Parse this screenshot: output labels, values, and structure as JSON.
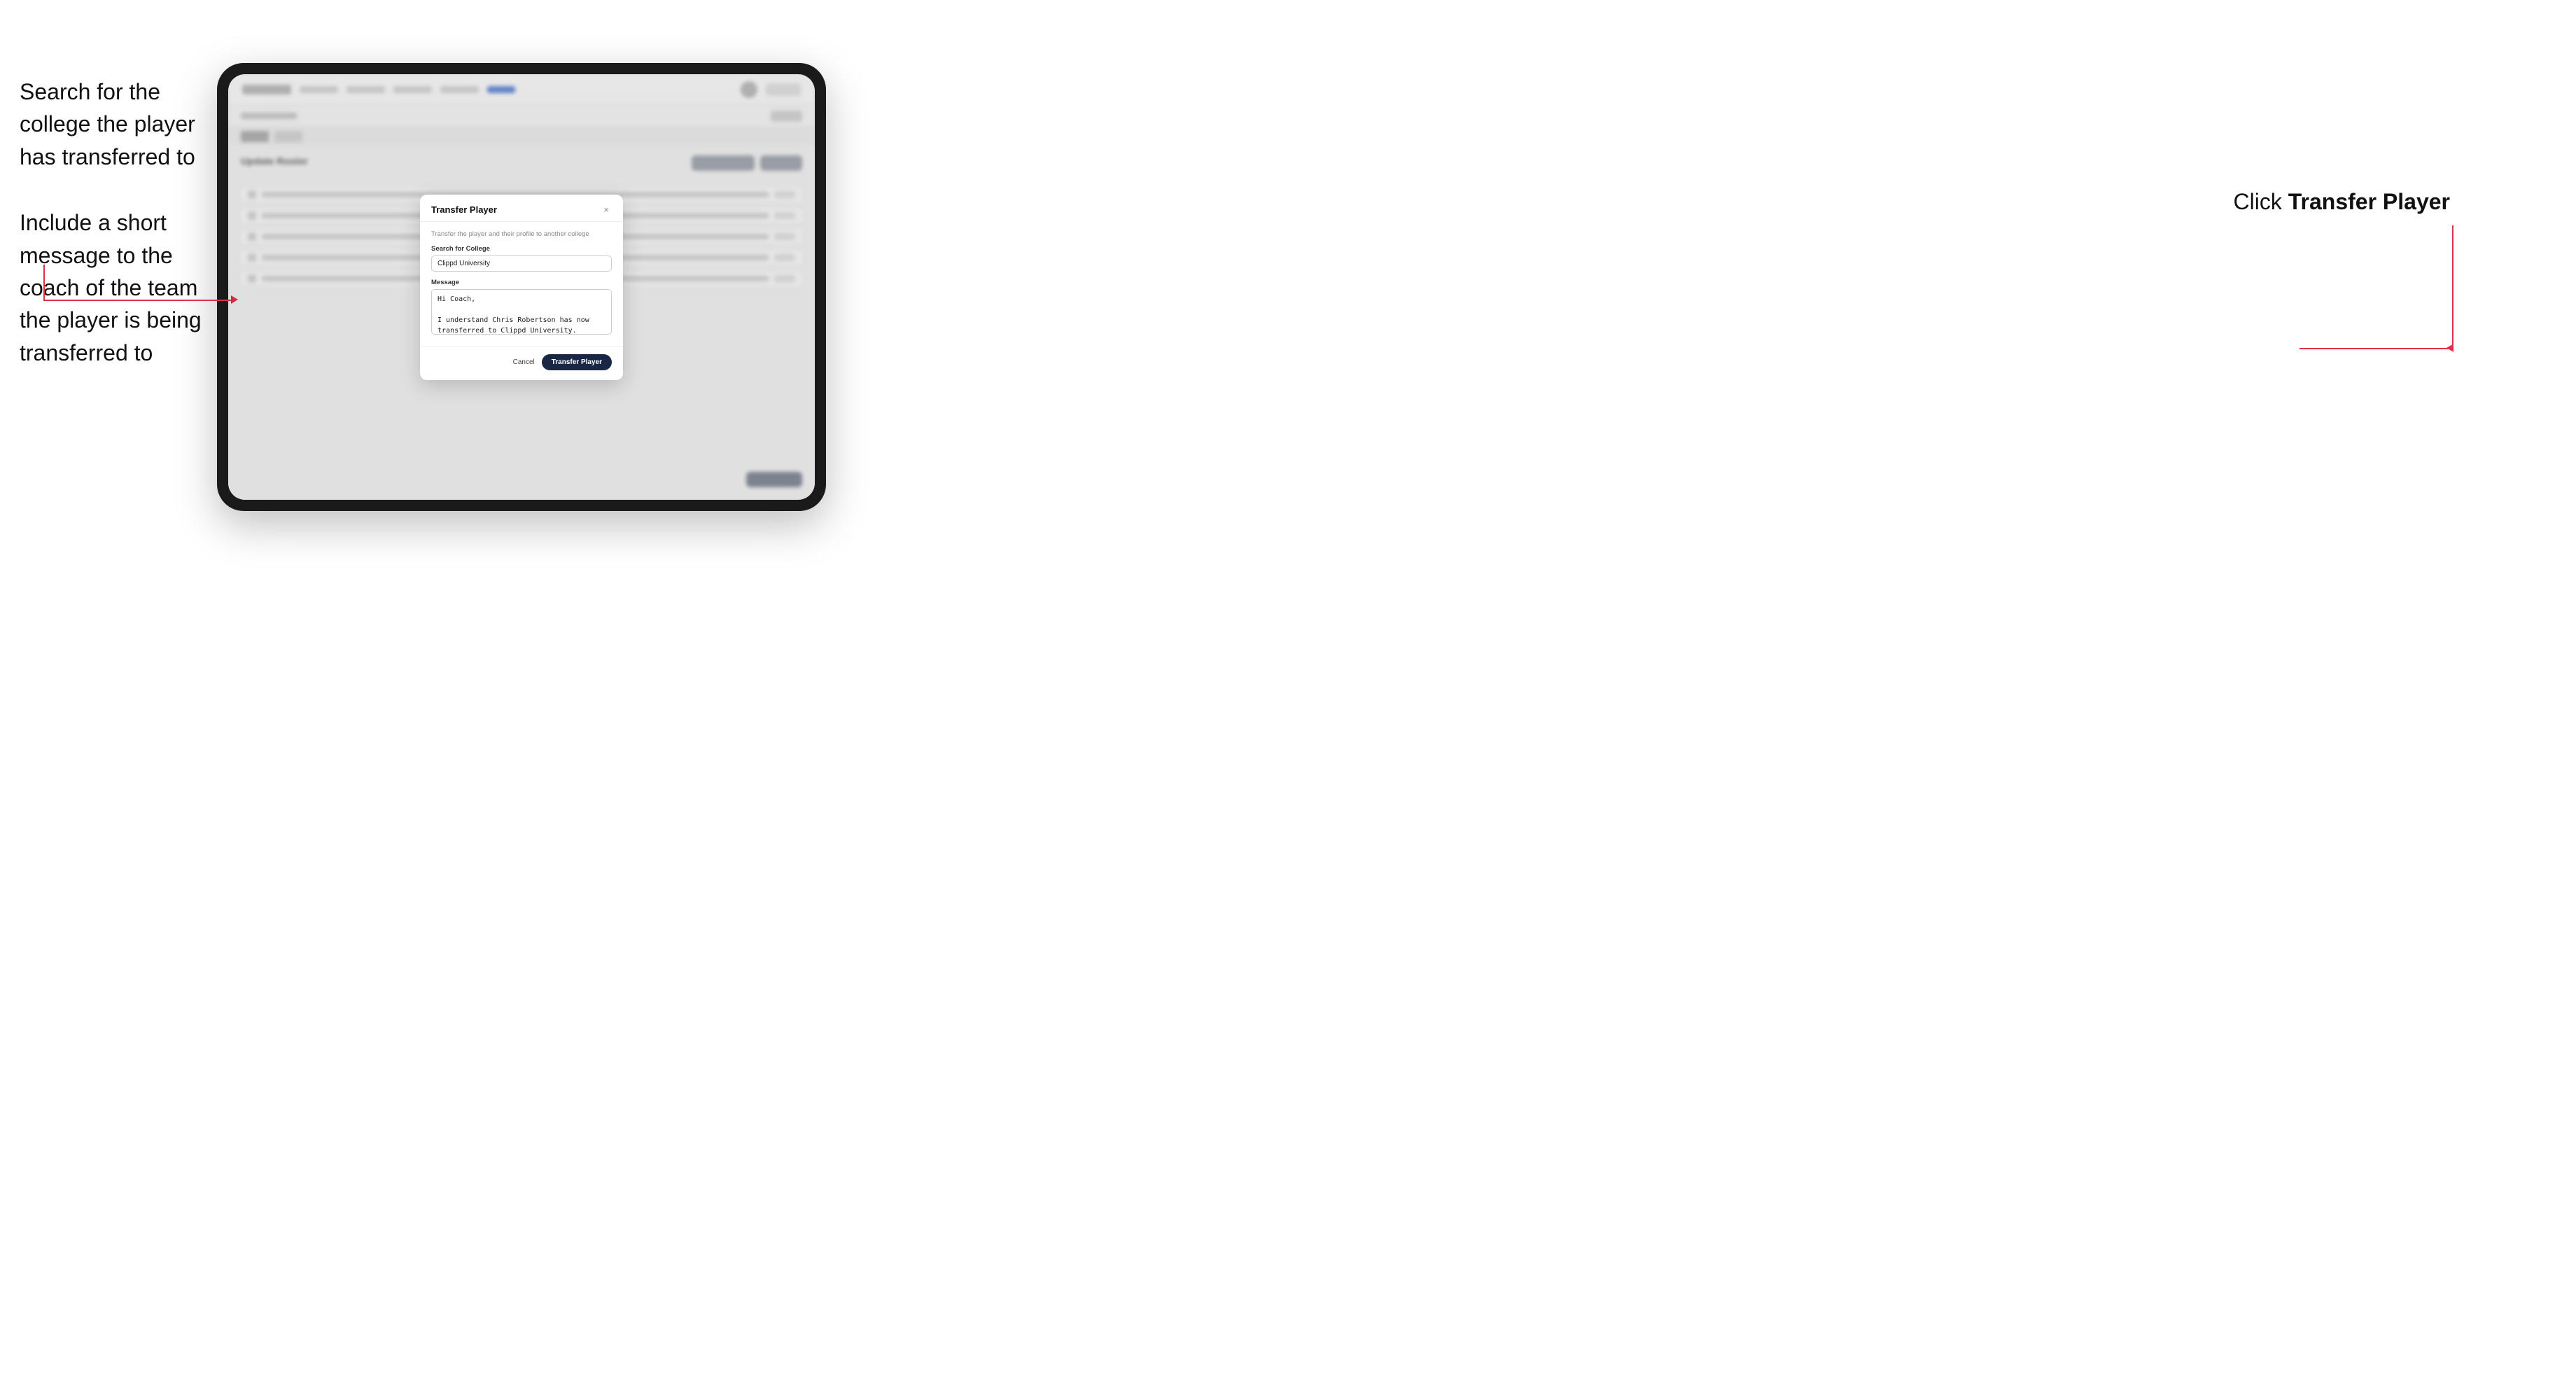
{
  "annotations": {
    "left_top": "Search for the college the player has transferred to",
    "left_bottom": "Include a short message to the coach of the team the player is being transferred to",
    "right": "Click ",
    "right_bold": "Transfer Player"
  },
  "tablet": {
    "navbar": {
      "logo_alt": "logo",
      "items": [
        "nav-item-1",
        "nav-item-2",
        "nav-item-3",
        "nav-item-4",
        "nav-item-active"
      ],
      "action_btn": "button"
    },
    "update_roster_title": "Update Roster"
  },
  "dialog": {
    "title": "Transfer Player",
    "close_label": "×",
    "subtitle": "Transfer the player and their profile to another college",
    "college_label": "Search for College",
    "college_value": "Clippd University",
    "message_label": "Message",
    "message_value": "Hi Coach,\n\nI understand Chris Robertson has now transferred to Clippd University. Please accept this transfer request when you can.",
    "cancel_label": "Cancel",
    "transfer_label": "Transfer Player"
  }
}
